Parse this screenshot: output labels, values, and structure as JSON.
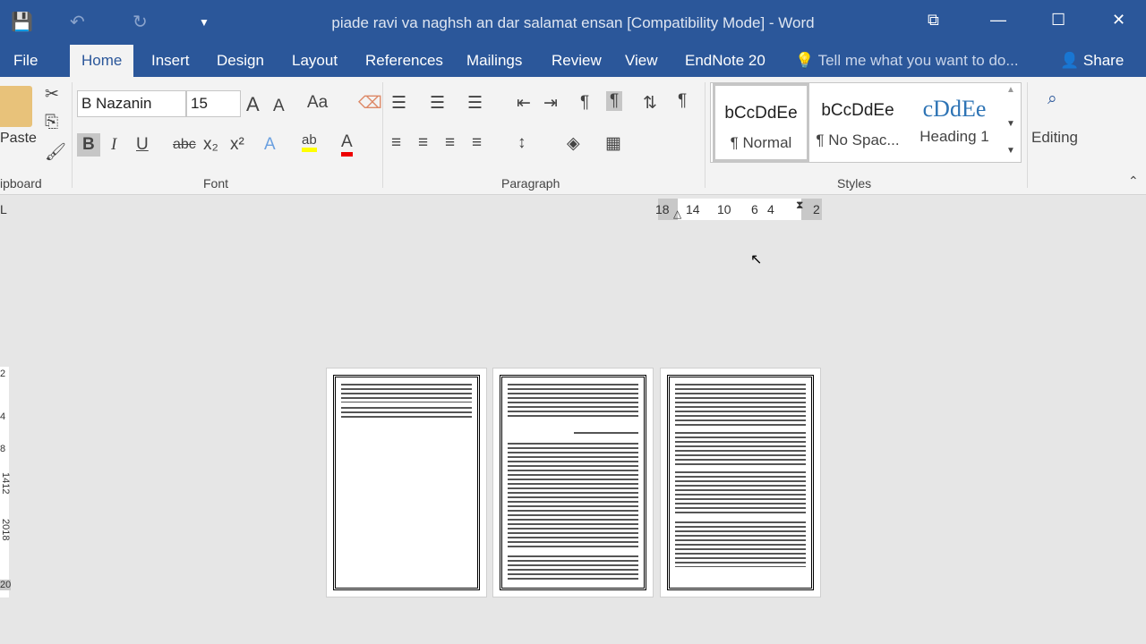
{
  "window": {
    "title": "piade ravi va naghsh an dar salamat ensan [Compatibility Mode] - Word"
  },
  "tabs": [
    "File",
    "Home",
    "Insert",
    "Design",
    "Layout",
    "References",
    "Mailings",
    "Review",
    "View",
    "EndNote 20"
  ],
  "tell_me": "Tell me what you want to do...",
  "share": "Share",
  "clipboard": {
    "paste": "Paste",
    "label": "ipboard"
  },
  "font": {
    "name": "B Nazanin",
    "size": "15",
    "label": "Font",
    "case": "Aa",
    "bold": "B",
    "italic": "I",
    "underline": "U",
    "strike": "abc",
    "sub": "x₂",
    "sup": "x²"
  },
  "paragraph": {
    "label": "Paragraph"
  },
  "styles": {
    "label": "Styles",
    "items": [
      {
        "preview": "bCcDdEe",
        "name": "¶ Normal"
      },
      {
        "preview": "bCcDdEe",
        "name": "¶ No Spac..."
      },
      {
        "preview": "cDdEe",
        "name": "Heading 1"
      }
    ]
  },
  "editing": {
    "label": "Editing"
  },
  "ruler": {
    "numbers": [
      "18",
      "14",
      "10",
      "6",
      "4",
      "2"
    ]
  },
  "vruler": {
    "numbers": [
      "2",
      "4",
      "8",
      "1412",
      "2018",
      "20"
    ]
  },
  "colors": {
    "accent": "#2b579a",
    "highlight": "#ffff00",
    "font_color": "#ff0000"
  }
}
